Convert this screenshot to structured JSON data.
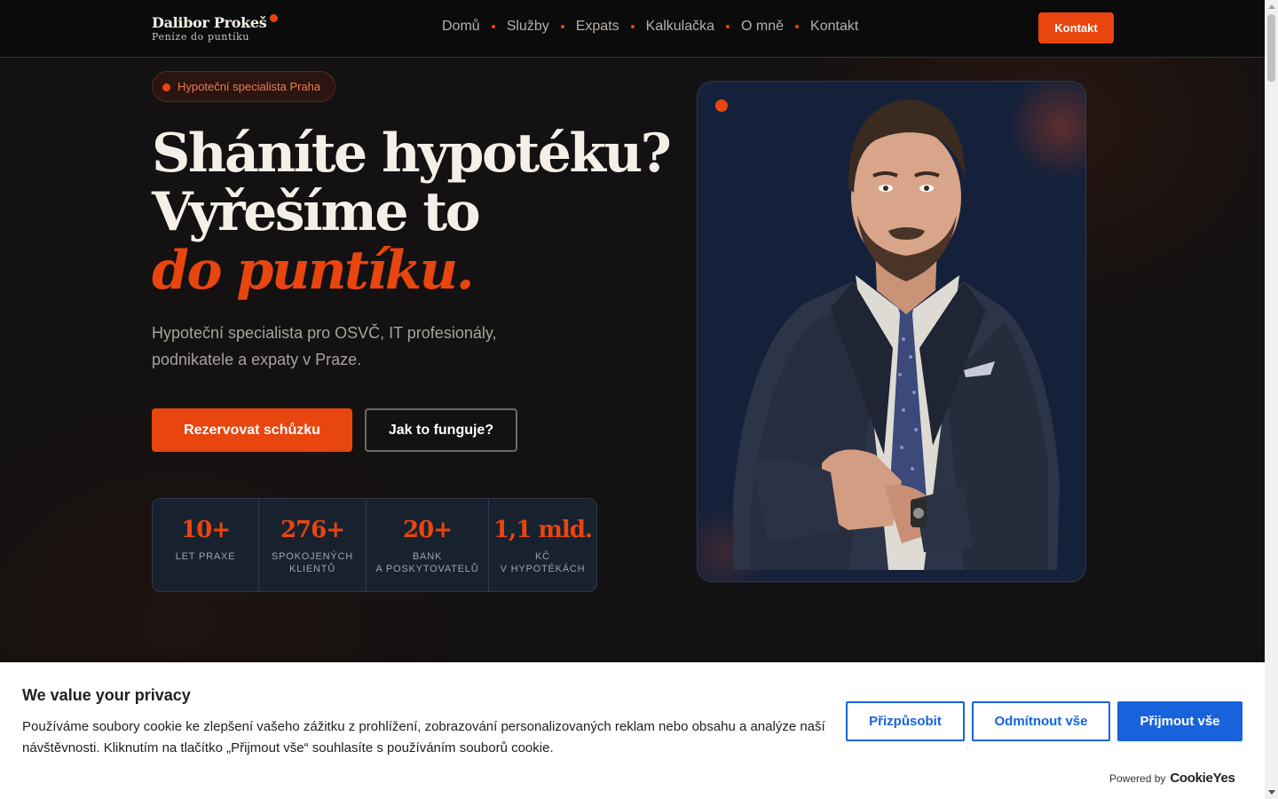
{
  "brand": {
    "name": "Dalibor Prokeš",
    "tagline": "Peníze do puntíku"
  },
  "nav": {
    "items": [
      "Domů",
      "Služby",
      "Expats",
      "Kalkulačka",
      "O mně",
      "Kontakt"
    ],
    "cta": "Kontakt"
  },
  "hero": {
    "badge": "Hypoteční specialista Praha",
    "headline_line1": "Sháníte hypotéku?",
    "headline_line2": "Vyřešíme to",
    "headline_accent": "do puntíku.",
    "subtitle": "Hypoteční specialista pro OSVČ, IT profesionály, podnikatele a expaty v Praze.",
    "primary_button": "Rezervovat schůzku",
    "secondary_button": "Jak to funguje?"
  },
  "stats": [
    {
      "value": "10+",
      "label": "LET PRAXE"
    },
    {
      "value": "276+",
      "label": "SPOKOJENÝCH\nKLIENTŮ"
    },
    {
      "value": "20+",
      "label": "BANK\nA POSKYTOVATELŮ"
    },
    {
      "value": "1,1 mld.",
      "label": "KČ\nV HYPOTÉKÁCH"
    }
  ],
  "cookie": {
    "title": "We value your privacy",
    "text": "Používáme soubory cookie ke zlepšení vašeho zážitku z prohlížení, zobrazování personalizovaných reklam nebo obsahu a analýze naší návštěvnosti. Kliknutím na tlačítko „Přijmout vše“ souhlasíte s používáním souborů cookie.",
    "customize": "Přizpůsobit",
    "reject": "Odmítnout vše",
    "accept": "Přijmout vše",
    "powered_by": "Powered by",
    "powered_logo": "CookieYes"
  },
  "colors": {
    "accent": "#e8450f",
    "background": "#131111",
    "stats_bg": "#18222f",
    "cookie_primary": "#1863dc"
  }
}
